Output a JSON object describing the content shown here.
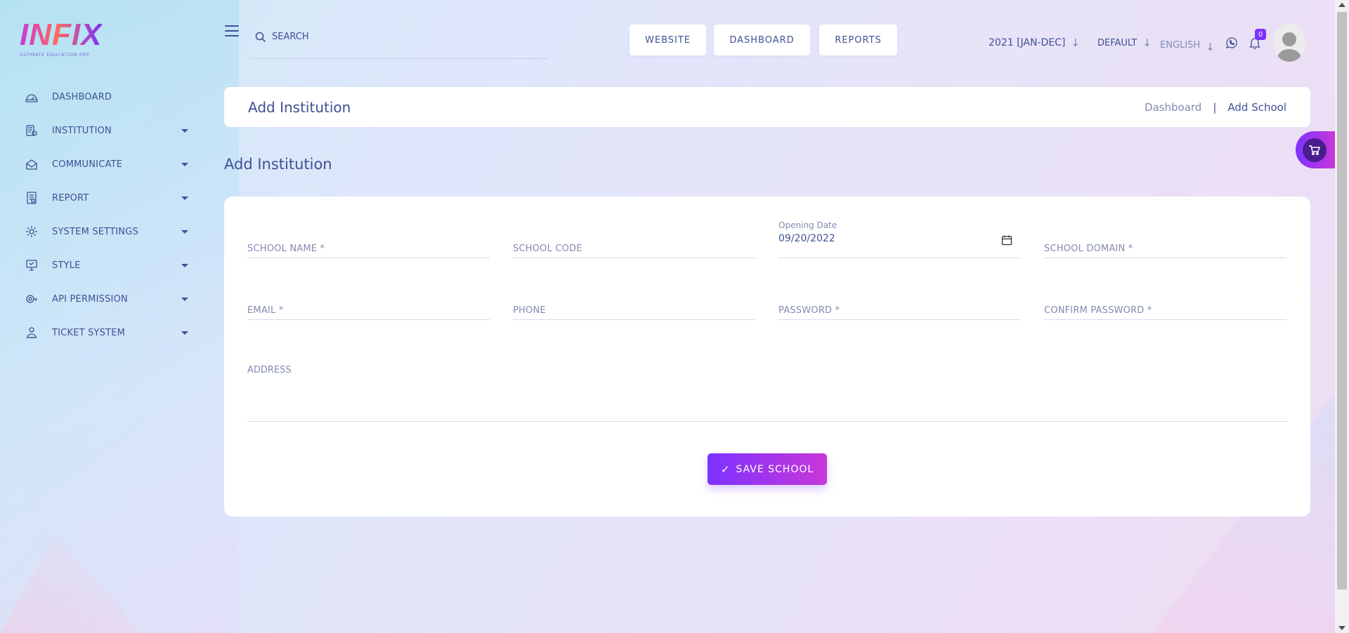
{
  "brand": {
    "logo_text": "INFIX",
    "tagline": "ULTIMATE EDUCATION ERP"
  },
  "sidebar": {
    "items": [
      {
        "label": "DASHBOARD",
        "icon": "dashboard-icon",
        "has_caret": false
      },
      {
        "label": "INSTITUTION",
        "icon": "institution-icon",
        "has_caret": true
      },
      {
        "label": "COMMUNICATE",
        "icon": "communicate-icon",
        "has_caret": true
      },
      {
        "label": "REPORT",
        "icon": "report-icon",
        "has_caret": true
      },
      {
        "label": "SYSTEM SETTINGS",
        "icon": "settings-icon",
        "has_caret": true
      },
      {
        "label": "STYLE",
        "icon": "style-icon",
        "has_caret": true
      },
      {
        "label": "API PERMISSION",
        "icon": "api-icon",
        "has_caret": true
      },
      {
        "label": "TICKET SYSTEM",
        "icon": "ticket-icon",
        "has_caret": true
      }
    ]
  },
  "header": {
    "search_placeholder": "SEARCH",
    "buttons": {
      "website": "WEBSITE",
      "dashboard": "DASHBOARD",
      "reports": "REPORTS"
    },
    "academic_year": "2021 [JAN-DEC]",
    "theme": "DEFAULT",
    "language": "ENGLISH",
    "notification_count": "0"
  },
  "title_card": {
    "title": "Add Institution",
    "breadcrumb": {
      "home": "Dashboard",
      "separator": "|",
      "current": "Add School"
    }
  },
  "form": {
    "section_title": "Add Institution",
    "fields": {
      "school_name": "SCHOOL NAME *",
      "school_code": "SCHOOL CODE",
      "opening_date_label": "Opening Date",
      "opening_date_value": "09/20/2022",
      "school_domain": "SCHOOL DOMAIN *",
      "email": "EMAIL *",
      "phone": "PHONE",
      "password": "PASSWORD *",
      "confirm_password": "CONFIRM PASSWORD *",
      "address": "ADDRESS"
    },
    "save_label": "SAVE SCHOOL"
  },
  "colors": {
    "primary": "#7c32ff",
    "accent": "#c738d8",
    "text": "#415094",
    "muted": "#828bb2"
  }
}
